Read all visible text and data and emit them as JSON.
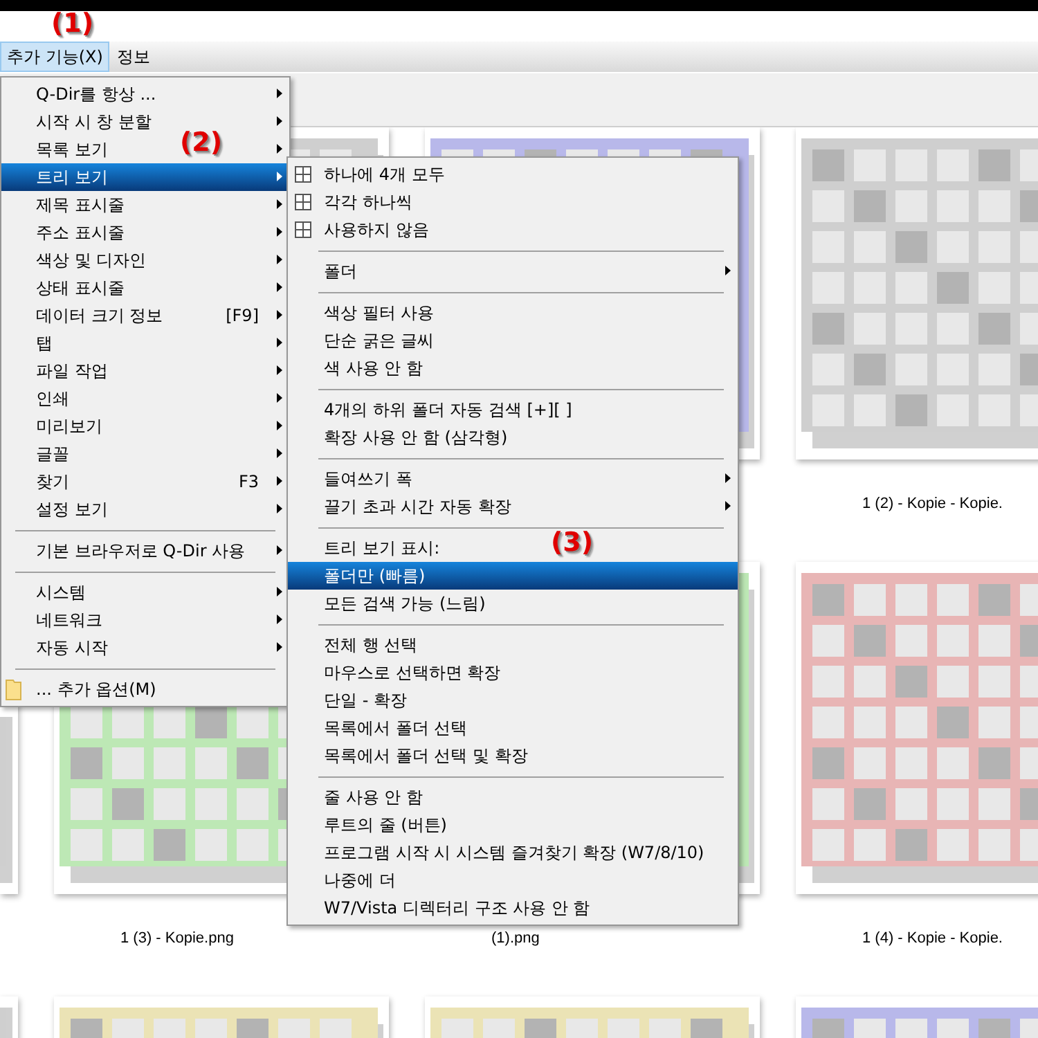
{
  "annotations": [
    "(1)",
    "(2)",
    "(3)"
  ],
  "menubar": [
    {
      "label": "추가 기능(X)",
      "selected": true
    },
    {
      "label": "정보",
      "selected": false
    }
  ],
  "main_menu": [
    {
      "kind": "submenu",
      "label": "Q-Dir를 항상 ...",
      "selected": false
    },
    {
      "kind": "submenu",
      "label": "시작 시 창 분할",
      "selected": false
    },
    {
      "kind": "submenu",
      "label": "목록 보기",
      "selected": false
    },
    {
      "kind": "submenu",
      "label": "트리 보기",
      "selected": true
    },
    {
      "kind": "submenu",
      "label": "제목 표시줄",
      "selected": false
    },
    {
      "kind": "submenu",
      "label": "주소 표시줄",
      "selected": false
    },
    {
      "kind": "submenu",
      "label": "색상 및 디자인",
      "selected": false
    },
    {
      "kind": "submenu",
      "label": "상태 표시줄",
      "selected": false
    },
    {
      "kind": "submenu",
      "label": "데이터 크기 정보",
      "shortcut": "[F9]",
      "selected": false
    },
    {
      "kind": "submenu",
      "label": "탭",
      "selected": false
    },
    {
      "kind": "submenu",
      "label": "파일 작업",
      "selected": false
    },
    {
      "kind": "submenu",
      "label": "인쇄",
      "selected": false
    },
    {
      "kind": "submenu",
      "label": "미리보기",
      "selected": false
    },
    {
      "kind": "submenu",
      "label": "글꼴",
      "selected": false
    },
    {
      "kind": "submenu",
      "label": "찾기",
      "shortcut": "F3",
      "selected": false
    },
    {
      "kind": "submenu",
      "label": "설정 보기",
      "selected": false
    },
    {
      "kind": "separator"
    },
    {
      "kind": "submenu",
      "label": "기본 브라우저로 Q-Dir 사용",
      "selected": false
    },
    {
      "kind": "separator"
    },
    {
      "kind": "submenu",
      "label": "시스템",
      "selected": false
    },
    {
      "kind": "submenu",
      "label": "네트워크",
      "selected": false
    },
    {
      "kind": "submenu",
      "label": "자동 시작",
      "selected": false
    },
    {
      "kind": "separator"
    },
    {
      "kind": "folder-item",
      "label": "... 추가 옵션(M)",
      "selected": false
    }
  ],
  "tree_submenu": [
    {
      "kind": "grid-item",
      "label": "하나에 4개 모두",
      "selected": false
    },
    {
      "kind": "grid-item",
      "label": "각각 하나씩",
      "selected": false
    },
    {
      "kind": "grid-item",
      "label": "사용하지 않음",
      "selected": false
    },
    {
      "kind": "separator"
    },
    {
      "kind": "submenu",
      "label": "폴더",
      "selected": false
    },
    {
      "kind": "separator"
    },
    {
      "kind": "item",
      "label": "색상 필터 사용",
      "selected": false
    },
    {
      "kind": "item",
      "label": "단순 굵은 글씨",
      "selected": false
    },
    {
      "kind": "item",
      "label": "색 사용 안 함",
      "selected": false
    },
    {
      "kind": "separator"
    },
    {
      "kind": "item",
      "label": "4개의 하위 폴더 자동 검색 [+][ ]",
      "selected": false
    },
    {
      "kind": "item",
      "label": "확장 사용 안 함 (삼각형)",
      "selected": false
    },
    {
      "kind": "separator"
    },
    {
      "kind": "submenu",
      "label": "들여쓰기 폭",
      "selected": false
    },
    {
      "kind": "submenu",
      "label": "끌기 초과 시간 자동 확장",
      "selected": false
    },
    {
      "kind": "separator"
    },
    {
      "kind": "header",
      "label": "트리 보기 표시:"
    },
    {
      "kind": "item",
      "label": "폴더만 (빠름)",
      "selected": true
    },
    {
      "kind": "item",
      "label": "모든 검색 가능 (느림)",
      "selected": false
    },
    {
      "kind": "separator"
    },
    {
      "kind": "item",
      "label": "전체 행 선택",
      "selected": false
    },
    {
      "kind": "item",
      "label": "마우스로 선택하면 확장",
      "selected": false
    },
    {
      "kind": "item",
      "label": "단일 - 확장",
      "selected": false
    },
    {
      "kind": "item",
      "label": "목록에서 폴더 선택",
      "selected": false
    },
    {
      "kind": "item",
      "label": "목록에서 폴더 선택 및 확장",
      "selected": false
    },
    {
      "kind": "separator"
    },
    {
      "kind": "item",
      "label": "줄 사용 안 함",
      "selected": false
    },
    {
      "kind": "item",
      "label": "루트의 줄 (버튼)",
      "selected": false
    },
    {
      "kind": "item",
      "label": "프로그램 시작 시 시스템 즐겨찾기 확장 (W7/8/10)",
      "selected": false
    },
    {
      "kind": "item",
      "label": "나중에 더",
      "selected": false
    },
    {
      "kind": "item",
      "label": "W7/Vista 디렉터리 구조 사용 안 함",
      "selected": false
    }
  ],
  "thumbnails": [
    {
      "color": "#cfcfcf"
    },
    {
      "color": "#b8b8ea"
    },
    {
      "color": "#cfcfcf",
      "caption": "1 (2) - Kopie - Kopie."
    },
    {
      "color": "#cfcfcf"
    },
    {
      "color": "#bde8b5",
      "caption": "1 (3) - Kopie.png"
    },
    {
      "color": "#bde8b5",
      "caption": "(1).png"
    },
    {
      "color": "#e8b5b5",
      "caption": "1 (4) - Kopie - Kopie."
    },
    {
      "color": "#cfcfcf"
    },
    {
      "color": "#ebe3b5"
    },
    {
      "color": "#ebe3b5"
    },
    {
      "color": "#b8b8ea"
    }
  ]
}
